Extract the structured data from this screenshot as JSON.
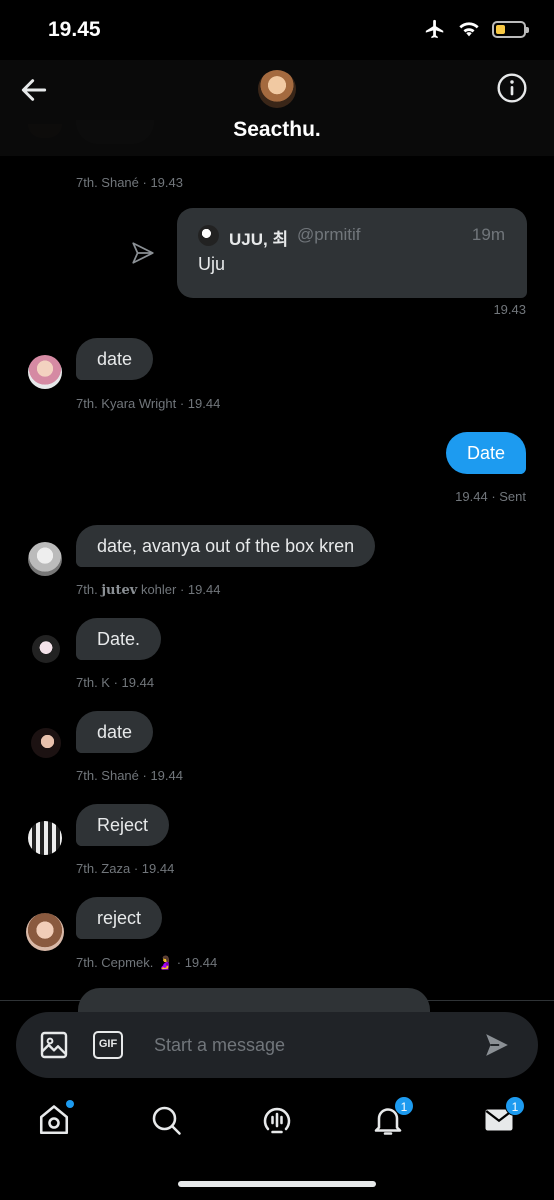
{
  "status_bar": {
    "time": "19.45",
    "icons": [
      "airplane-icon",
      "wifi-icon",
      "battery-icon"
    ]
  },
  "header": {
    "title": "Seacthu.",
    "back_icon": "arrow-left-icon",
    "info_icon": "info-icon"
  },
  "top_message": {
    "meta": "7th. Shané · 19.43"
  },
  "quote": {
    "name": "UJU, 최",
    "handle": "@prmitif",
    "age": "19m",
    "text": "Uju",
    "sent_time": "19.43"
  },
  "messages": [
    {
      "text": "date",
      "sender": "7th. Kyara Wright",
      "time": "19.44"
    },
    {
      "text": "date, avanya out of the box kren",
      "sender_prefix": "7th.",
      "sender_styled": "jutev",
      "sender_suffix": "kohler",
      "time": "19.44"
    },
    {
      "text": "Date.",
      "sender": "7th. K",
      "time": "19.44"
    },
    {
      "text": "date",
      "sender": "7th. Shané",
      "time": "19.44"
    },
    {
      "text": "Reject",
      "sender": "7th. Zaza",
      "time": "19.44"
    },
    {
      "text": "reject",
      "sender": "7th. Cepmek.",
      "time": "19.44",
      "emoji": "🤰"
    }
  ],
  "sent_message": {
    "text": "Date",
    "meta": "19.44 · Sent"
  },
  "composer": {
    "placeholder": "Start a message",
    "gif_label": "GIF"
  },
  "tabbar": {
    "home_icon": "home-icon",
    "search_icon": "search-icon",
    "spaces_icon": "spaces-icon",
    "notifications_badge": "1",
    "messages_badge": "1"
  },
  "colors": {
    "accent": "#1d9bf0",
    "bubble": "#2f3336",
    "background": "#000000"
  }
}
